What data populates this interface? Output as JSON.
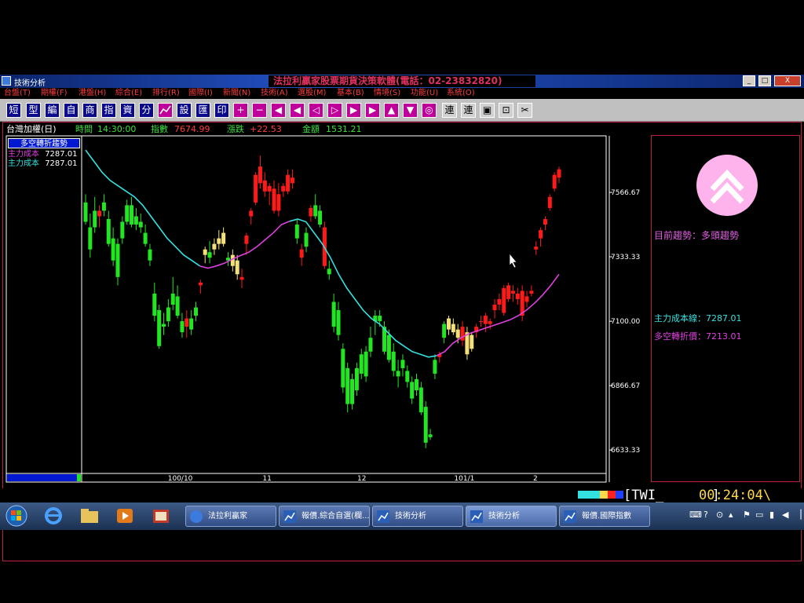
{
  "window": {
    "title": "技術分析",
    "banner": "法拉利贏家股票期貨決策軟體(電話：02-23832820)",
    "buttons": [
      "_",
      "□",
      "X"
    ]
  },
  "menu": [
    "台盤(T)",
    "期權(F)",
    "港盤(H)",
    "綜合(E)",
    "排行(R)",
    "國際(I)",
    "新聞(N)",
    "技術(A)",
    "選股(M)",
    "基本(B)",
    "情境(S)",
    "功能(U)",
    "系統(O)"
  ],
  "toolbar": {
    "text_buttons": [
      "短",
      "型",
      "編",
      "自",
      "商",
      "指",
      "資",
      "分"
    ],
    "text_buttons2": [
      "設",
      "匯",
      "印"
    ]
  },
  "quote": {
    "name": "台灣加權(日)",
    "time_label": "時間",
    "time": "14:30:00",
    "index_label": "指數",
    "index": "7674.99",
    "change_label": "漲跌",
    "change": "+22.53",
    "amount_label": "金額",
    "amount": "1531.21"
  },
  "legend": {
    "title": "多空轉折趨勢",
    "line1_label": "主力成本",
    "line1_value": "7287.01",
    "line2_label": "主力成本",
    "line2_value": "7287.01"
  },
  "side": {
    "trend_label": "目前趨勢：多頭趨勢",
    "cost_line": "主力成本線：7287.01",
    "turn_price": "多空轉折價：7213.01"
  },
  "status": {
    "code": "[TWI_      ]",
    "time": "00:24:04\\"
  },
  "taskbar": {
    "tasks": [
      "法拉利贏家",
      "報價.綜合自選(欄...",
      "技術分析",
      "技術分析",
      "報價.國際指數"
    ]
  },
  "colors": {
    "up": "#ff1a1a",
    "down": "#22e622",
    "neutral": "#f4e07a",
    "ma_down": "#33e0e0",
    "ma_up": "#e040e0"
  },
  "chart_data": {
    "type": "candlestick",
    "y_ticks": [
      "7566.67",
      "7333.33",
      "7100.00",
      "6866.67",
      "6633.33"
    ],
    "ylim": [
      6560,
      7760
    ],
    "x_ticks": [
      "100/10",
      "11",
      "12",
      "101/1",
      "2"
    ],
    "candles": [
      {
        "o": 7530,
        "h": 7560,
        "l": 7450,
        "c": 7460,
        "t": "down"
      },
      {
        "o": 7440,
        "h": 7490,
        "l": 7330,
        "c": 7360,
        "t": "down"
      },
      {
        "o": 7500,
        "h": 7550,
        "l": 7420,
        "c": 7440,
        "t": "down"
      },
      {
        "o": 7480,
        "h": 7520,
        "l": 7440,
        "c": 7500,
        "t": "up"
      },
      {
        "o": 7530,
        "h": 7560,
        "l": 7480,
        "c": 7500,
        "t": "down"
      },
      {
        "o": 7470,
        "h": 7500,
        "l": 7370,
        "c": 7380,
        "t": "down"
      },
      {
        "o": 7400,
        "h": 7440,
        "l": 7300,
        "c": 7320,
        "t": "down"
      },
      {
        "o": 7380,
        "h": 7400,
        "l": 7230,
        "c": 7260,
        "t": "down"
      },
      {
        "o": 7460,
        "h": 7480,
        "l": 7380,
        "c": 7400,
        "t": "down"
      },
      {
        "o": 7520,
        "h": 7540,
        "l": 7450,
        "c": 7460,
        "t": "down"
      },
      {
        "o": 7520,
        "h": 7550,
        "l": 7440,
        "c": 7450,
        "t": "down"
      },
      {
        "o": 7480,
        "h": 7510,
        "l": 7430,
        "c": 7450,
        "t": "down"
      },
      {
        "o": 7460,
        "h": 7490,
        "l": 7420,
        "c": 7440,
        "t": "down"
      },
      {
        "o": 7420,
        "h": 7450,
        "l": 7370,
        "c": 7380,
        "t": "down"
      },
      {
        "o": 7360,
        "h": 7380,
        "l": 7300,
        "c": 7320,
        "t": "down"
      },
      {
        "o": 7200,
        "h": 7240,
        "l": 7100,
        "c": 7120,
        "t": "down"
      },
      {
        "o": 7140,
        "h": 7160,
        "l": 7000,
        "c": 7010,
        "t": "down"
      },
      {
        "o": 7090,
        "h": 7130,
        "l": 7050,
        "c": 7080,
        "t": "down"
      },
      {
        "o": 7150,
        "h": 7180,
        "l": 7080,
        "c": 7100,
        "t": "down"
      },
      {
        "o": 7200,
        "h": 7260,
        "l": 7140,
        "c": 7160,
        "t": "down"
      },
      {
        "o": 7190,
        "h": 7230,
        "l": 7110,
        "c": 7120,
        "t": "down"
      },
      {
        "o": 7100,
        "h": 7130,
        "l": 7040,
        "c": 7060,
        "t": "down"
      },
      {
        "o": 7080,
        "h": 7140,
        "l": 7040,
        "c": 7110,
        "t": "up"
      },
      {
        "o": 7110,
        "h": 7140,
        "l": 7050,
        "c": 7070,
        "t": "down"
      },
      {
        "o": 7150,
        "h": 7170,
        "l": 7100,
        "c": 7120,
        "t": "down"
      },
      {
        "o": 7230,
        "h": 7250,
        "l": 7200,
        "c": 7240,
        "t": "up"
      },
      {
        "o": 7340,
        "h": 7370,
        "l": 7310,
        "c": 7360,
        "t": "neutral"
      },
      {
        "o": 7350,
        "h": 7390,
        "l": 7310,
        "c": 7330,
        "t": "down"
      },
      {
        "o": 7380,
        "h": 7400,
        "l": 7340,
        "c": 7360,
        "t": "neutral"
      },
      {
        "o": 7380,
        "h": 7430,
        "l": 7360,
        "c": 7400,
        "t": "neutral"
      },
      {
        "o": 7420,
        "h": 7440,
        "l": 7370,
        "c": 7380,
        "t": "neutral"
      },
      {
        "o": 7330,
        "h": 7350,
        "l": 7300,
        "c": 7320,
        "t": "down"
      },
      {
        "o": 7340,
        "h": 7360,
        "l": 7280,
        "c": 7300,
        "t": "neutral"
      },
      {
        "o": 7320,
        "h": 7340,
        "l": 7250,
        "c": 7270,
        "t": "neutral"
      },
      {
        "o": 7260,
        "h": 7290,
        "l": 7220,
        "c": 7250,
        "t": "up"
      },
      {
        "o": 7380,
        "h": 7420,
        "l": 7340,
        "c": 7410,
        "t": "up"
      },
      {
        "o": 7480,
        "h": 7510,
        "l": 7450,
        "c": 7500,
        "t": "up"
      },
      {
        "o": 7530,
        "h": 7640,
        "l": 7520,
        "c": 7630,
        "t": "up"
      },
      {
        "o": 7660,
        "h": 7700,
        "l": 7580,
        "c": 7600,
        "t": "up"
      },
      {
        "o": 7610,
        "h": 7640,
        "l": 7550,
        "c": 7570,
        "t": "up"
      },
      {
        "o": 7570,
        "h": 7600,
        "l": 7520,
        "c": 7590,
        "t": "up"
      },
      {
        "o": 7580,
        "h": 7610,
        "l": 7490,
        "c": 7500,
        "t": "up"
      },
      {
        "o": 7560,
        "h": 7600,
        "l": 7480,
        "c": 7500,
        "t": "up"
      },
      {
        "o": 7570,
        "h": 7600,
        "l": 7550,
        "c": 7590,
        "t": "up"
      },
      {
        "o": 7630,
        "h": 7650,
        "l": 7560,
        "c": 7570,
        "t": "up"
      },
      {
        "o": 7620,
        "h": 7650,
        "l": 7580,
        "c": 7600,
        "t": "up"
      },
      {
        "o": 7450,
        "h": 7470,
        "l": 7380,
        "c": 7400,
        "t": "down"
      },
      {
        "o": 7330,
        "h": 7380,
        "l": 7300,
        "c": 7360,
        "t": "up"
      },
      {
        "o": 7420,
        "h": 7440,
        "l": 7350,
        "c": 7370,
        "t": "down"
      },
      {
        "o": 7480,
        "h": 7520,
        "l": 7460,
        "c": 7510,
        "t": "up"
      },
      {
        "o": 7520,
        "h": 7560,
        "l": 7470,
        "c": 7480,
        "t": "down"
      },
      {
        "o": 7500,
        "h": 7520,
        "l": 7440,
        "c": 7450,
        "t": "down"
      },
      {
        "o": 7440,
        "h": 7460,
        "l": 7290,
        "c": 7300,
        "t": "up"
      },
      {
        "o": 7290,
        "h": 7320,
        "l": 7250,
        "c": 7270,
        "t": "down"
      },
      {
        "o": 7170,
        "h": 7200,
        "l": 7060,
        "c": 7080,
        "t": "down"
      },
      {
        "o": 7140,
        "h": 7170,
        "l": 7030,
        "c": 7050,
        "t": "down"
      },
      {
        "o": 7000,
        "h": 7020,
        "l": 6840,
        "c": 6860,
        "t": "down"
      },
      {
        "o": 6930,
        "h": 6950,
        "l": 6770,
        "c": 6800,
        "t": "down"
      },
      {
        "o": 6890,
        "h": 6910,
        "l": 6780,
        "c": 6800,
        "t": "down"
      },
      {
        "o": 6930,
        "h": 6950,
        "l": 6830,
        "c": 6850,
        "t": "down"
      },
      {
        "o": 6980,
        "h": 7000,
        "l": 6890,
        "c": 6910,
        "t": "down"
      },
      {
        "o": 6990,
        "h": 7010,
        "l": 6880,
        "c": 6900,
        "t": "down"
      },
      {
        "o": 7040,
        "h": 7080,
        "l": 6970,
        "c": 6990,
        "t": "down"
      },
      {
        "o": 7100,
        "h": 7140,
        "l": 7050,
        "c": 7120,
        "t": "down"
      },
      {
        "o": 7120,
        "h": 7140,
        "l": 7080,
        "c": 7100,
        "t": "down"
      },
      {
        "o": 7080,
        "h": 7100,
        "l": 6980,
        "c": 6990,
        "t": "down"
      },
      {
        "o": 7050,
        "h": 7070,
        "l": 6950,
        "c": 6960,
        "t": "down"
      },
      {
        "o": 6990,
        "h": 7020,
        "l": 6900,
        "c": 6920,
        "t": "down"
      },
      {
        "o": 6920,
        "h": 6960,
        "l": 6860,
        "c": 6900,
        "t": "down"
      },
      {
        "o": 6960,
        "h": 6980,
        "l": 6900,
        "c": 6930,
        "t": "down"
      },
      {
        "o": 6920,
        "h": 6940,
        "l": 6860,
        "c": 6880,
        "t": "down"
      },
      {
        "o": 6880,
        "h": 6900,
        "l": 6800,
        "c": 6820,
        "t": "down"
      },
      {
        "o": 6890,
        "h": 6910,
        "l": 6830,
        "c": 6850,
        "t": "down"
      },
      {
        "o": 6860,
        "h": 6880,
        "l": 6760,
        "c": 6770,
        "t": "down"
      },
      {
        "o": 6790,
        "h": 6810,
        "l": 6640,
        "c": 6660,
        "t": "down"
      },
      {
        "o": 6690,
        "h": 6710,
        "l": 6670,
        "c": 6680,
        "t": "down"
      },
      {
        "o": 6960,
        "h": 6980,
        "l": 6890,
        "c": 6910,
        "t": "down"
      },
      {
        "o": 6970,
        "h": 6990,
        "l": 6950,
        "c": 6980,
        "t": "up"
      },
      {
        "o": 7040,
        "h": 7100,
        "l": 7020,
        "c": 7090,
        "t": "down"
      },
      {
        "o": 7070,
        "h": 7120,
        "l": 7050,
        "c": 7110,
        "t": "neutral"
      },
      {
        "o": 7090,
        "h": 7110,
        "l": 7050,
        "c": 7060,
        "t": "neutral"
      },
      {
        "o": 7070,
        "h": 7090,
        "l": 7020,
        "c": 7040,
        "t": "neutral"
      },
      {
        "o": 7030,
        "h": 7100,
        "l": 7010,
        "c": 7080,
        "t": "up"
      },
      {
        "o": 7060,
        "h": 7080,
        "l": 6960,
        "c": 6980,
        "t": "neutral"
      },
      {
        "o": 7000,
        "h": 7060,
        "l": 6990,
        "c": 7050,
        "t": "neutral"
      },
      {
        "o": 7060,
        "h": 7090,
        "l": 7040,
        "c": 7080,
        "t": "up"
      },
      {
        "o": 7100,
        "h": 7120,
        "l": 7080,
        "c": 7100,
        "t": "up"
      },
      {
        "o": 7090,
        "h": 7130,
        "l": 7060,
        "c": 7120,
        "t": "up"
      },
      {
        "o": 7090,
        "h": 7110,
        "l": 7070,
        "c": 7100,
        "t": "up"
      },
      {
        "o": 7140,
        "h": 7180,
        "l": 7110,
        "c": 7160,
        "t": "up"
      },
      {
        "o": 7180,
        "h": 7200,
        "l": 7140,
        "c": 7160,
        "t": "up"
      },
      {
        "o": 7130,
        "h": 7230,
        "l": 7120,
        "c": 7220,
        "t": "up"
      },
      {
        "o": 7180,
        "h": 7240,
        "l": 7170,
        "c": 7230,
        "t": "up"
      },
      {
        "o": 7200,
        "h": 7230,
        "l": 7170,
        "c": 7210,
        "t": "up"
      },
      {
        "o": 7200,
        "h": 7220,
        "l": 7160,
        "c": 7180,
        "t": "up"
      },
      {
        "o": 7120,
        "h": 7230,
        "l": 7100,
        "c": 7210,
        "t": "up"
      },
      {
        "o": 7170,
        "h": 7210,
        "l": 7150,
        "c": 7190,
        "t": "up"
      },
      {
        "o": 7210,
        "h": 7230,
        "l": 7190,
        "c": 7200,
        "t": "up"
      },
      {
        "o": 7370,
        "h": 7390,
        "l": 7340,
        "c": 7360,
        "t": "up"
      },
      {
        "o": 7400,
        "h": 7440,
        "l": 7370,
        "c": 7430,
        "t": "up"
      },
      {
        "o": 7450,
        "h": 7480,
        "l": 7430,
        "c": 7470,
        "t": "up"
      },
      {
        "o": 7510,
        "h": 7560,
        "l": 7500,
        "c": 7550,
        "t": "up"
      },
      {
        "o": 7580,
        "h": 7640,
        "l": 7570,
        "c": 7630,
        "t": "up"
      },
      {
        "o": 7620,
        "h": 7660,
        "l": 7600,
        "c": 7650,
        "t": "up"
      }
    ],
    "ma": [
      7720,
      7680,
      7640,
      7610,
      7590,
      7570,
      7550,
      7520,
      7480,
      7440,
      7400,
      7370,
      7340,
      7320,
      7300,
      7292,
      7300,
      7310,
      7325,
      7338,
      7350,
      7370,
      7395,
      7420,
      7450,
      7462,
      7470,
      7460,
      7420,
      7380,
      7330,
      7270,
      7220,
      7180,
      7140,
      7110,
      7090,
      7060,
      7030,
      7010,
      6990,
      6980,
      6970,
      6975,
      6990,
      7020,
      7040,
      7055,
      7065,
      7075,
      7085,
      7095,
      7105,
      7120,
      7140,
      7165,
      7195,
      7230,
      7270
    ],
    "ma_split": 32
  }
}
